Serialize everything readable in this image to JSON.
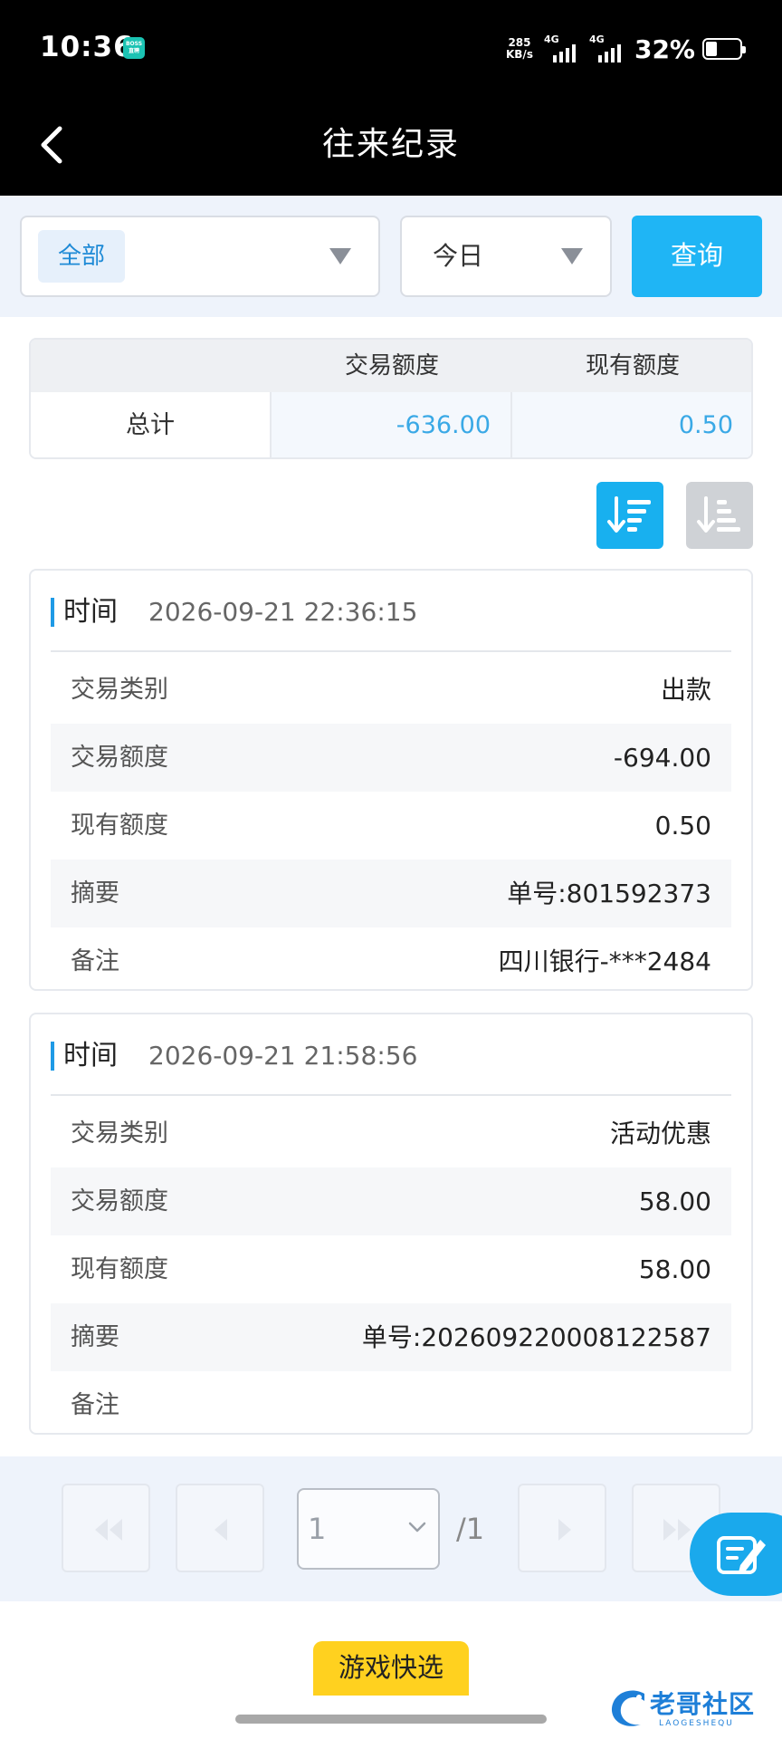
{
  "status_bar": {
    "time": "10:36",
    "app_badge": "BOSS直聘",
    "net_speed_value": "285",
    "net_speed_unit": "KB/s",
    "signal1_label": "4G",
    "signal2_label": "4G",
    "battery_percent": "32%"
  },
  "header": {
    "title": "往来纪录",
    "back_icon": "chevron-left-icon"
  },
  "filters": {
    "category_value": "全部",
    "date_value": "今日",
    "query_label": "查询"
  },
  "summary": {
    "col_trade": "交易额度",
    "col_balance": "现有额度",
    "row_label": "总计",
    "trade_value": "-636.00",
    "balance_value": "0.50"
  },
  "sort": {
    "desc_icon": "sort-descending-icon",
    "asc_icon": "sort-ascending-icon"
  },
  "records": [
    {
      "time_label": "时间",
      "time_value": "2026-09-21 22:36:15",
      "fields": [
        {
          "key": "交易类别",
          "value": "出款"
        },
        {
          "key": "交易额度",
          "value": "-694.00"
        },
        {
          "key": "现有额度",
          "value": "0.50"
        },
        {
          "key": "摘要",
          "value": "单号:801592373"
        },
        {
          "key": "备注",
          "value": "四川银行-***2484"
        }
      ]
    },
    {
      "time_label": "时间",
      "time_value": "2026-09-21 21:58:56",
      "fields": [
        {
          "key": "交易类别",
          "value": "活动优惠"
        },
        {
          "key": "交易额度",
          "value": "58.00"
        },
        {
          "key": "现有额度",
          "value": "58.00"
        },
        {
          "key": "摘要",
          "value": "单号:2026092200081225​87"
        },
        {
          "key": "备注",
          "value": ""
        }
      ]
    }
  ],
  "pager": {
    "current_page": "1",
    "total_pages": "/1"
  },
  "bottom": {
    "game_button_label": "游戏快选",
    "watermark_text": "老哥社区",
    "watermark_sub": "LAOGESHEQU"
  },
  "colors": {
    "accent": "#1fb5f5",
    "header_bg": "#000000",
    "filter_bg": "#eef3fb",
    "yellow": "#ffd11f"
  }
}
